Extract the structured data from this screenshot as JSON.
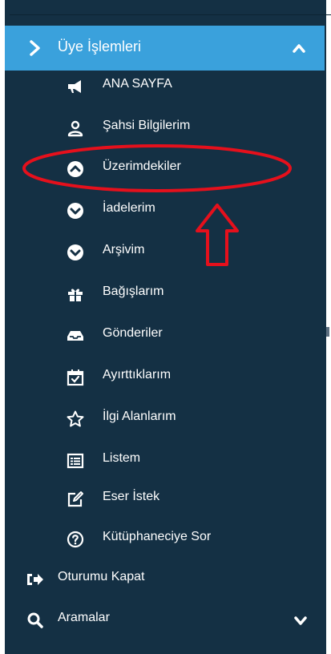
{
  "menu": {
    "section_label": "Üye İşlemleri",
    "items": [
      {
        "label": "ANA SAYFA",
        "icon": "megaphone-icon"
      },
      {
        "label": "Şahsi Bilgilerim",
        "icon": "user-icon"
      },
      {
        "label": "Üzerimdekiler",
        "icon": "chevron-up-circle-icon"
      },
      {
        "label": "İadelerim",
        "icon": "chevron-down-circle-icon"
      },
      {
        "label": "Arşivim",
        "icon": "chevron-down-circle-icon"
      },
      {
        "label": "Bağışlarım",
        "icon": "gift-icon"
      },
      {
        "label": "Gönderiler",
        "icon": "inbox-icon"
      },
      {
        "label": "Ayırttıklarım",
        "icon": "calendar-check-icon"
      },
      {
        "label": "İlgi Alanlarım",
        "icon": "star-icon"
      },
      {
        "label": "Listem",
        "icon": "list-icon"
      },
      {
        "label": "Eser İstek",
        "icon": "edit-icon"
      },
      {
        "label": "Kütüphaneciye Sor",
        "icon": "question-circle-icon"
      }
    ],
    "logout_label": "Oturumu Kapat",
    "search_label": "Aramalar"
  },
  "colors": {
    "sidebar_bg": "#143044",
    "header_bg": "#3aa1dc",
    "annotation": "#e5101c"
  }
}
